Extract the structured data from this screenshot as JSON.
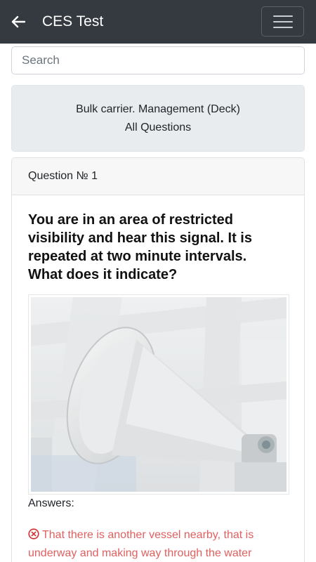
{
  "appbar": {
    "title": "CES Test",
    "back_icon": "arrow-left-icon",
    "menu_icon": "hamburger-menu-icon"
  },
  "search": {
    "placeholder": "Search",
    "value": ""
  },
  "info": {
    "line1": "Bulk carrier. Management (Deck)",
    "line2": "All Questions"
  },
  "question": {
    "header": "Question № 1",
    "text": "You are in an area of restricted visibility and hear this signal. It is repeated at two minute intervals. What does it indicate?",
    "image": "ship-horn-photo",
    "answers_label": "Answers:",
    "answers": [
      {
        "status": "wrong",
        "icon": "x-circle-icon",
        "color": "#e06060",
        "text": "That there is another vessel nearby, that is underway and making way through the water"
      }
    ]
  },
  "colors": {
    "appbar": "#343a40",
    "wrong_answer": "#e06060",
    "info_bg": "#e9ecef"
  }
}
